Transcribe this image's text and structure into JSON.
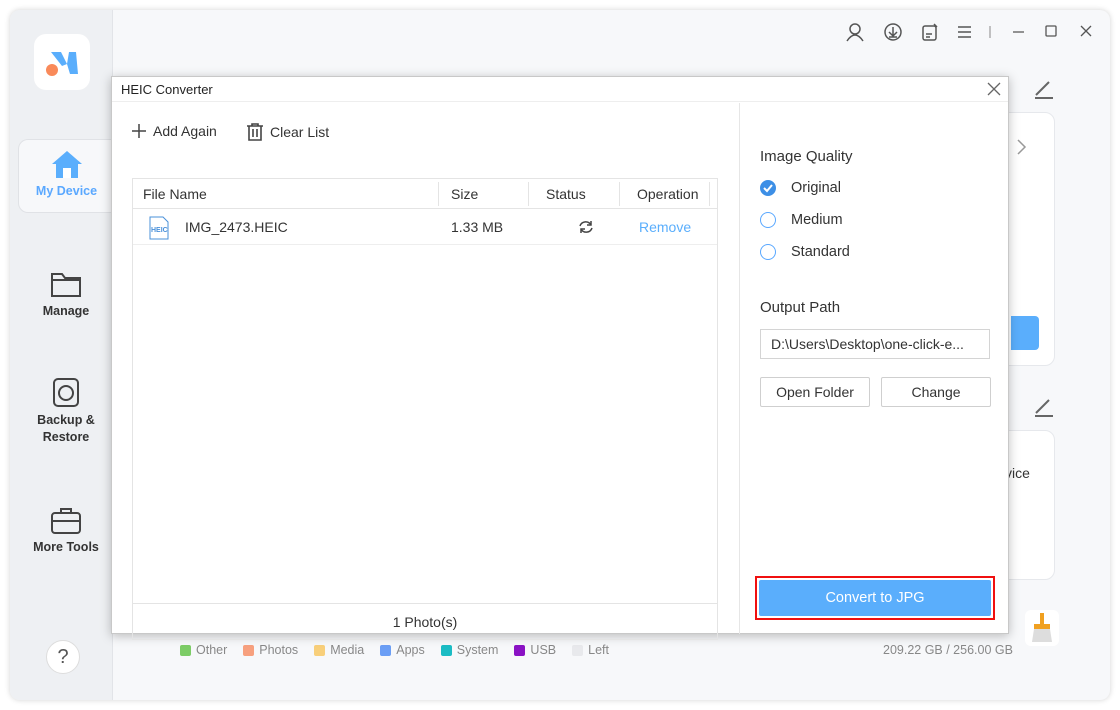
{
  "sidebar": {
    "items": [
      {
        "label": "My Device",
        "icon": "home-icon",
        "active": true
      },
      {
        "label": "Manage",
        "icon": "folder-icon"
      },
      {
        "label": "Backup &\nRestore",
        "icon": "backup-icon"
      },
      {
        "label": "More Tools",
        "icon": "toolbox-icon"
      }
    ],
    "help": "?"
  },
  "background": {
    "card_text": "vice",
    "storage": "209.22 GB / 256.00 GB",
    "legend": [
      {
        "label": "Other",
        "color": "#7ccc66"
      },
      {
        "label": "Photos",
        "color": "#f7a07e"
      },
      {
        "label": "Media",
        "color": "#f8cf7a"
      },
      {
        "label": "Apps",
        "color": "#6b9ef5"
      },
      {
        "label": "System",
        "color": "#1bbcc4"
      },
      {
        "label": "USB",
        "color": "#8a12c4"
      },
      {
        "label": "Left",
        "color": "#e8e9ec"
      }
    ]
  },
  "dialog": {
    "title": "HEIC Converter",
    "add_again": "Add Again",
    "clear_list": "Clear List",
    "columns": [
      "File Name",
      "Size",
      "Status",
      "Operation"
    ],
    "rows": [
      {
        "name": "IMG_2473.HEIC",
        "size": "1.33 MB",
        "status": "refresh-icon",
        "operation": "Remove",
        "file_badge": "HEIC"
      }
    ],
    "footer": "1 Photo(s)",
    "image_quality_label": "Image Quality",
    "quality_options": [
      {
        "label": "Original",
        "selected": true
      },
      {
        "label": "Medium",
        "selected": false
      },
      {
        "label": "Standard",
        "selected": false
      }
    ],
    "output_path_label": "Output Path",
    "output_path": "D:\\Users\\Desktop\\one-click-e...",
    "open_folder": "Open Folder",
    "change": "Change",
    "convert": "Convert to JPG",
    "accent": "#5aaefc"
  }
}
